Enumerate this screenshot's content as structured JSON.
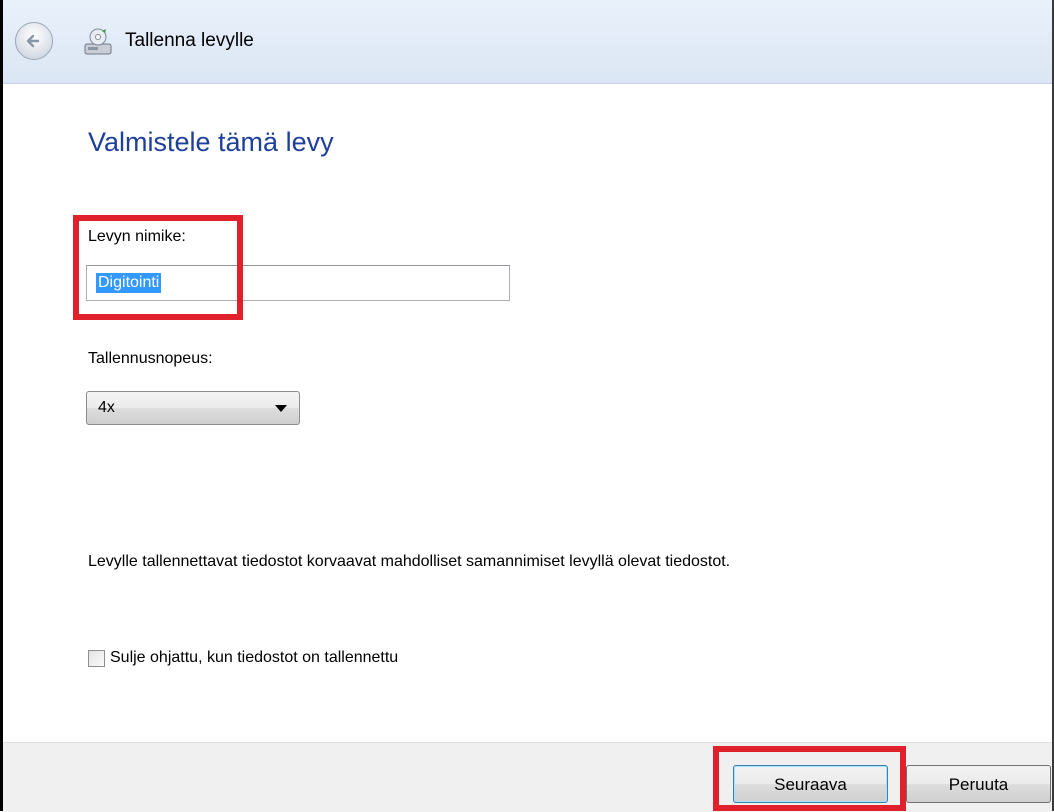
{
  "window": {
    "title": "Tallenna levylle"
  },
  "page": {
    "heading": "Valmistele tämä levy"
  },
  "disc_title": {
    "label": "Levyn nimike:",
    "value": "Digitointi"
  },
  "recording_speed": {
    "label": "Tallennusnopeus:",
    "selected": "4x"
  },
  "note": "Levylle tallennettavat tiedostot korvaavat mahdolliset samannimiset levyllä olevat tiedostot.",
  "close_option": {
    "label": "Sulje ohjattu, kun tiedostot on tallennettu",
    "checked": false
  },
  "buttons": {
    "next": "Seuraava",
    "cancel": "Peruuta"
  },
  "colors": {
    "heading": "#1e3f9a",
    "highlight": "#e0202a",
    "selection": "#3399ff"
  },
  "icons": {
    "back": "back-arrow-icon",
    "burn": "burn-disc-icon",
    "dropdown": "chevron-down-icon"
  }
}
